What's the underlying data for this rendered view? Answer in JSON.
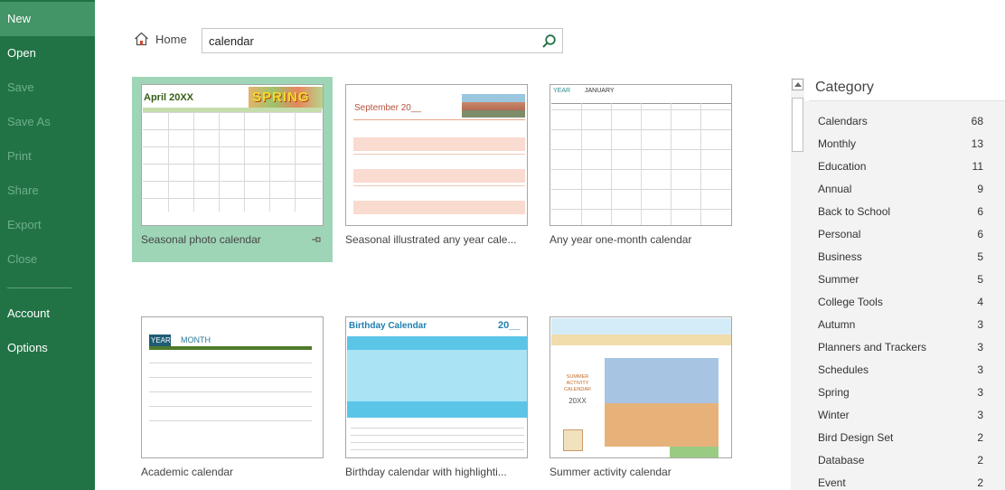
{
  "nav": {
    "items": [
      {
        "label": "New",
        "state": "active"
      },
      {
        "label": "Open",
        "state": "enabled"
      },
      {
        "label": "Save",
        "state": "disabled"
      },
      {
        "label": "Save As",
        "state": "disabled"
      },
      {
        "label": "Print",
        "state": "disabled"
      },
      {
        "label": "Share",
        "state": "disabled"
      },
      {
        "label": "Export",
        "state": "disabled"
      },
      {
        "label": "Close",
        "state": "disabled"
      }
    ],
    "bottom_items": [
      {
        "label": "Account"
      },
      {
        "label": "Options"
      }
    ]
  },
  "header": {
    "home_label": "Home",
    "search_value": "calendar",
    "home_icon": "house-icon",
    "search_icon": "magnifier-icon"
  },
  "templates": [
    {
      "label": "Seasonal photo calendar",
      "selected": true,
      "pinned_icon": "pin-icon",
      "preview": {
        "title": "April 20XX",
        "banner": "SPRING"
      }
    },
    {
      "label": "Seasonal illustrated any year cale...",
      "preview": {
        "title": "September 20__"
      }
    },
    {
      "label": "Any year one-month calendar",
      "preview": {
        "year": "YEAR",
        "month": "JANUARY"
      }
    },
    {
      "label": "Academic calendar",
      "preview": {
        "year": "YEAR",
        "month": "MONTH"
      }
    },
    {
      "label": "Birthday calendar with highlighti...",
      "preview": {
        "title": "Birthday Calendar",
        "year": "20__"
      }
    },
    {
      "label": "Summer activity calendar",
      "preview": {
        "heading": "SUMMER ACTIVITY CALENDAR",
        "year": "20XX"
      }
    }
  ],
  "category": {
    "title": "Category",
    "items": [
      {
        "name": "Calendars",
        "count": "68"
      },
      {
        "name": "Monthly",
        "count": "13"
      },
      {
        "name": "Education",
        "count": "11"
      },
      {
        "name": "Annual",
        "count": "9"
      },
      {
        "name": "Back to School",
        "count": "6"
      },
      {
        "name": "Personal",
        "count": "6"
      },
      {
        "name": "Business",
        "count": "5"
      },
      {
        "name": "Summer",
        "count": "5"
      },
      {
        "name": "College Tools",
        "count": "4"
      },
      {
        "name": "Autumn",
        "count": "3"
      },
      {
        "name": "Planners and Trackers",
        "count": "3"
      },
      {
        "name": "Schedules",
        "count": "3"
      },
      {
        "name": "Spring",
        "count": "3"
      },
      {
        "name": "Winter",
        "count": "3"
      },
      {
        "name": "Bird Design Set",
        "count": "2"
      },
      {
        "name": "Database",
        "count": "2"
      },
      {
        "name": "Event",
        "count": "2"
      }
    ]
  },
  "colors": {
    "nav_bg": "#217346",
    "nav_active": "#439467",
    "tile_selected": "#9fd5b7"
  }
}
